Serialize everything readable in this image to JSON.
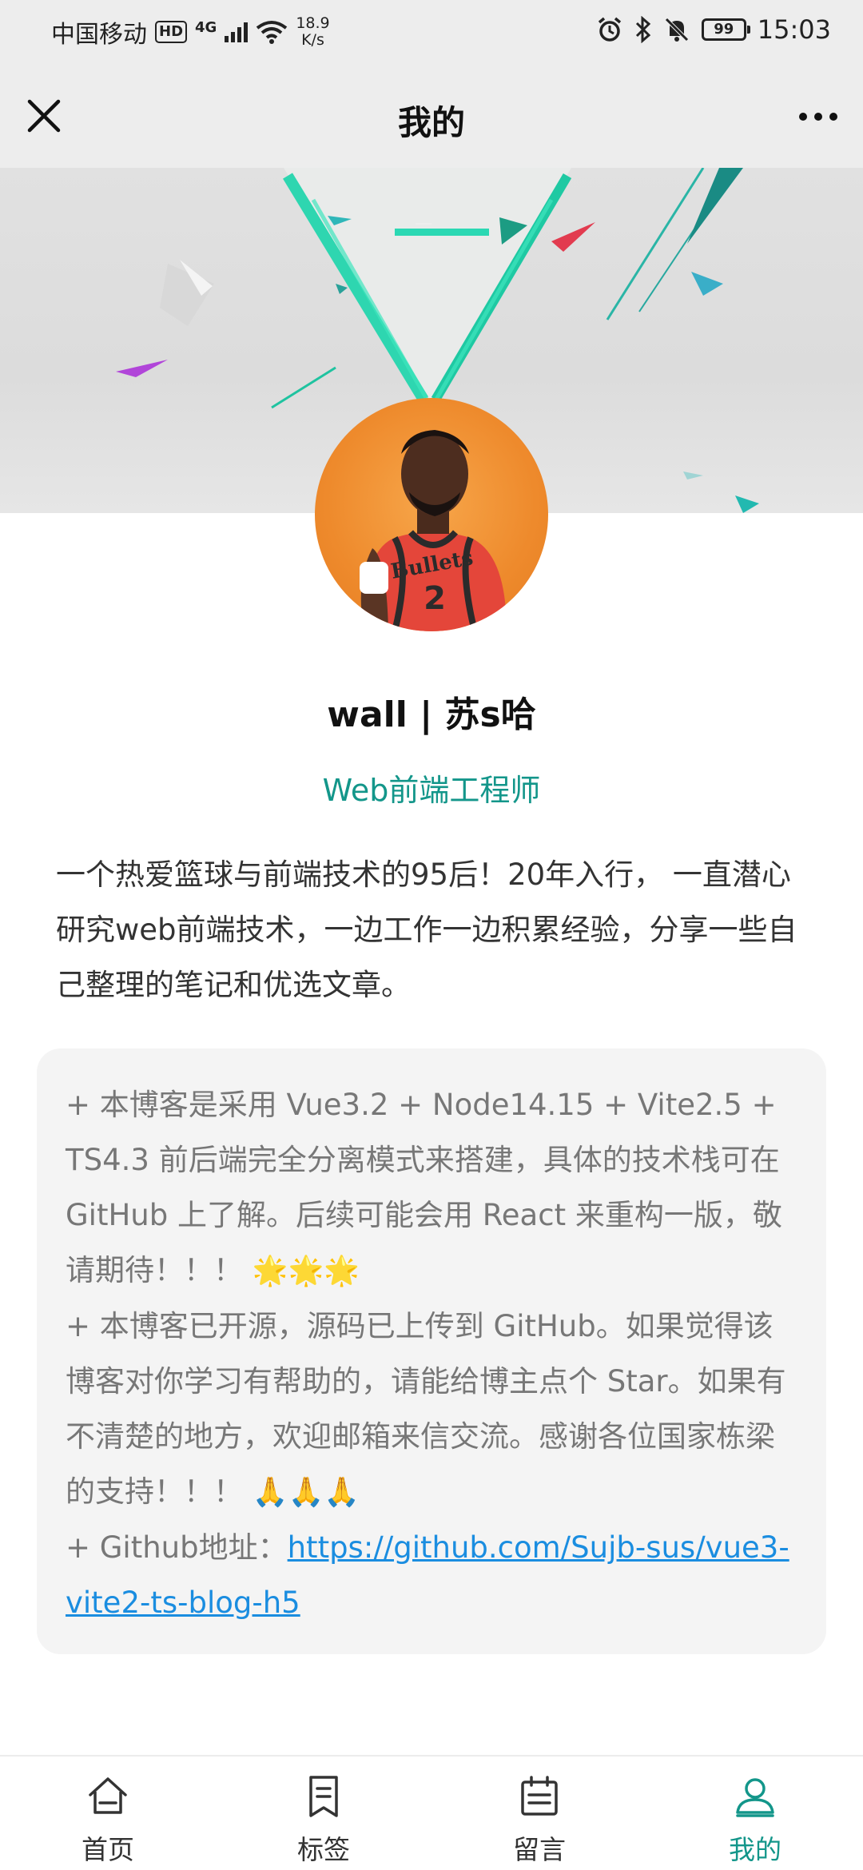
{
  "status_bar": {
    "carrier": "中国移动",
    "hd": "HD",
    "signal": "4G",
    "net_speed_value": "18.9",
    "net_speed_unit": "K/s",
    "battery": "99",
    "time": "15:03"
  },
  "nav": {
    "title": "我的"
  },
  "profile": {
    "name": "wall | 苏s哈",
    "job_title": "Web前端工程师",
    "intro": "一个热爱篮球与前端技术的95后！20年入行， 一直潜心研究web前端技术，一边工作一边积累经验，分享一些自己整理的笔记和优选文章。"
  },
  "notes": {
    "line1": "+ 本博客是采用 Vue3.2 + Node14.15 + Vite2.5 + TS4.3 前后端完全分离模式来搭建，具体的技术栈可在 GitHub 上了解。后续可能会用 React 来重构一版，敬请期待！！！",
    "line1_emoji": "🌟🌟🌟",
    "line2": "+ 本博客已开源，源码已上传到 GitHub。如果觉得该博客对你学习有帮助的，请能给博主点个 Star。如果有不清楚的地方，欢迎邮箱来信交流。感谢各位国家栋梁的支持！！！",
    "line2_emoji": "🙏🙏🙏",
    "github_prefix": "+ Github地址：",
    "github_link": "https://github.com/Sujb-sus/vue3-vite2-ts-blog-h5"
  },
  "tabs": [
    {
      "label": "首页",
      "icon": "home-icon",
      "active": false
    },
    {
      "label": "标签",
      "icon": "bookmark-icon",
      "active": false
    },
    {
      "label": "留言",
      "icon": "calendar-icon",
      "active": false
    },
    {
      "label": "我的",
      "icon": "user-icon",
      "active": true
    }
  ],
  "colors": {
    "accent": "#13968a",
    "link": "#1a8de0",
    "card_bg": "#f4f4f4",
    "nav_bg": "#ededed"
  }
}
